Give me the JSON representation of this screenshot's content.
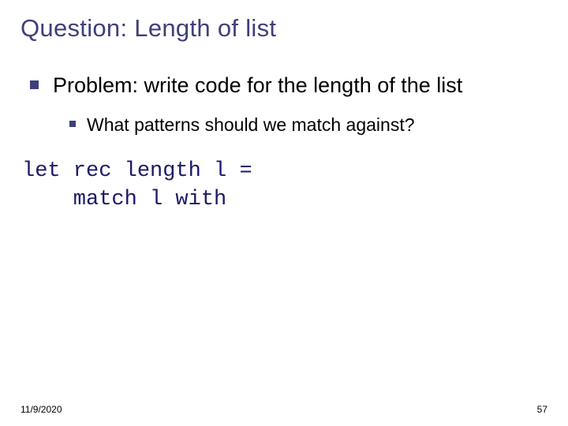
{
  "title": "Question: Length of list",
  "bullets": {
    "l1": "Problem: write code for the length of the list",
    "l2": "What patterns should we match against?"
  },
  "code": {
    "line1": "let rec length l =",
    "line2": "    match l with"
  },
  "footer": {
    "date": "11/9/2020",
    "page": "57"
  }
}
